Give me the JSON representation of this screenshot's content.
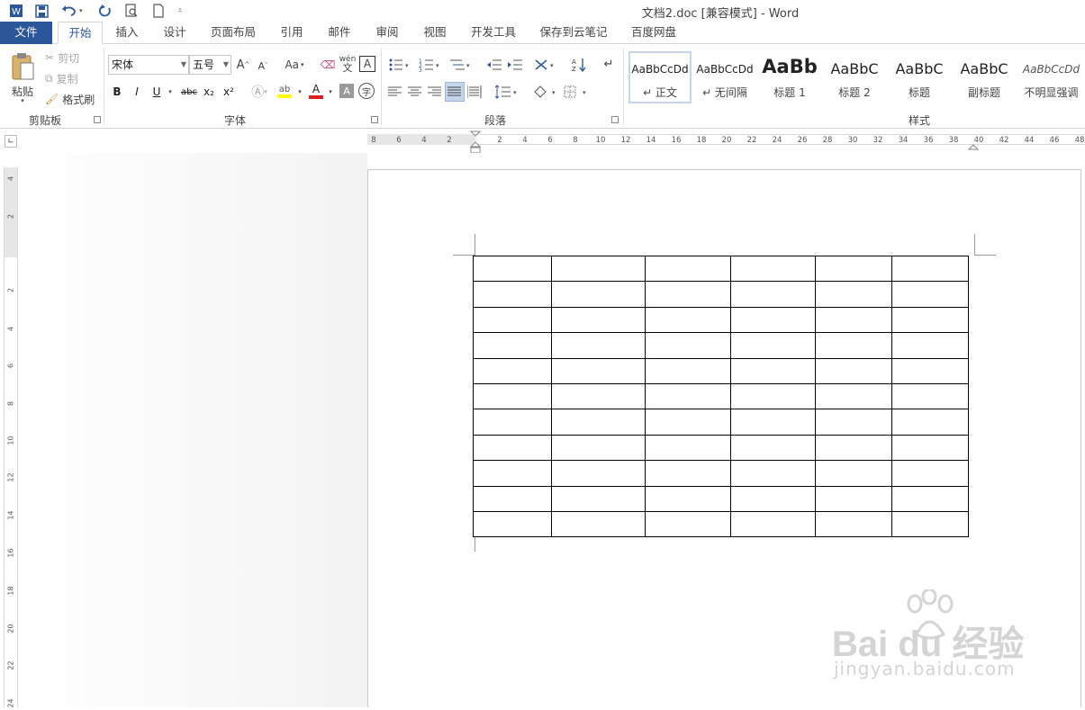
{
  "window": {
    "title": "文档2.doc [兼容模式] - Word"
  },
  "quick_access": [
    "word-logo-icon",
    "save-icon",
    "undo-icon",
    "redo-icon",
    "print-preview-icon",
    "new-document-icon",
    "customize-icon"
  ],
  "tabs": [
    {
      "label": "文件"
    },
    {
      "label": "开始"
    },
    {
      "label": "插入"
    },
    {
      "label": "设计"
    },
    {
      "label": "页面布局"
    },
    {
      "label": "引用"
    },
    {
      "label": "邮件"
    },
    {
      "label": "审阅"
    },
    {
      "label": "视图"
    },
    {
      "label": "开发工具"
    },
    {
      "label": "保存到云笔记"
    },
    {
      "label": "百度网盘"
    }
  ],
  "ribbon": {
    "clipboard": {
      "paste": "粘贴",
      "cut": "剪切",
      "copy": "复制",
      "format_painter": "格式刷",
      "group": "剪贴板"
    },
    "font": {
      "font_name": "宋体",
      "font_size": "五号",
      "change_case": "Aa",
      "bold": "B",
      "italic": "I",
      "underline": "U",
      "strike": "abc",
      "subscript": "x₂",
      "superscript": "x²",
      "phonetic": "wén",
      "border_char": "A",
      "font_color": "A",
      "shade_char": "A",
      "enclose": "字",
      "group": "字体"
    },
    "paragraph": {
      "group": "段落"
    },
    "styles": {
      "group": "样式",
      "items": [
        {
          "sample": "AaBbCcDd",
          "name": "↵ 正文"
        },
        {
          "sample": "AaBbCcDd",
          "name": "↵ 无间隔"
        },
        {
          "sample": "AaBb",
          "name": "标题 1"
        },
        {
          "sample": "AaBbC",
          "name": "标题 2"
        },
        {
          "sample": "AaBbC",
          "name": "标题"
        },
        {
          "sample": "AaBbC",
          "name": "副标题"
        },
        {
          "sample": "AaBbCcDd",
          "name": "不明显强调"
        }
      ]
    }
  },
  "hruler": [
    "8",
    "6",
    "4",
    "2",
    "2",
    "4",
    "6",
    "8",
    "10",
    "12",
    "14",
    "16",
    "18",
    "20",
    "22",
    "24",
    "26",
    "28",
    "30",
    "32",
    "34",
    "36",
    "38",
    "40",
    "42",
    "44",
    "46",
    "48"
  ],
  "vruler": [
    "4",
    "2",
    "2",
    "4",
    "6",
    "8",
    "10",
    "12",
    "14",
    "16",
    "18",
    "20",
    "22",
    "24"
  ],
  "table": {
    "rows": 11,
    "columns": 6
  },
  "watermark": {
    "brand": "Bai du 经验",
    "url": "jingyan.baidu.com"
  },
  "colors": {
    "accent": "#2b579a",
    "font_color_bar": "#e02020",
    "highlight_bar": "#ffff00"
  }
}
